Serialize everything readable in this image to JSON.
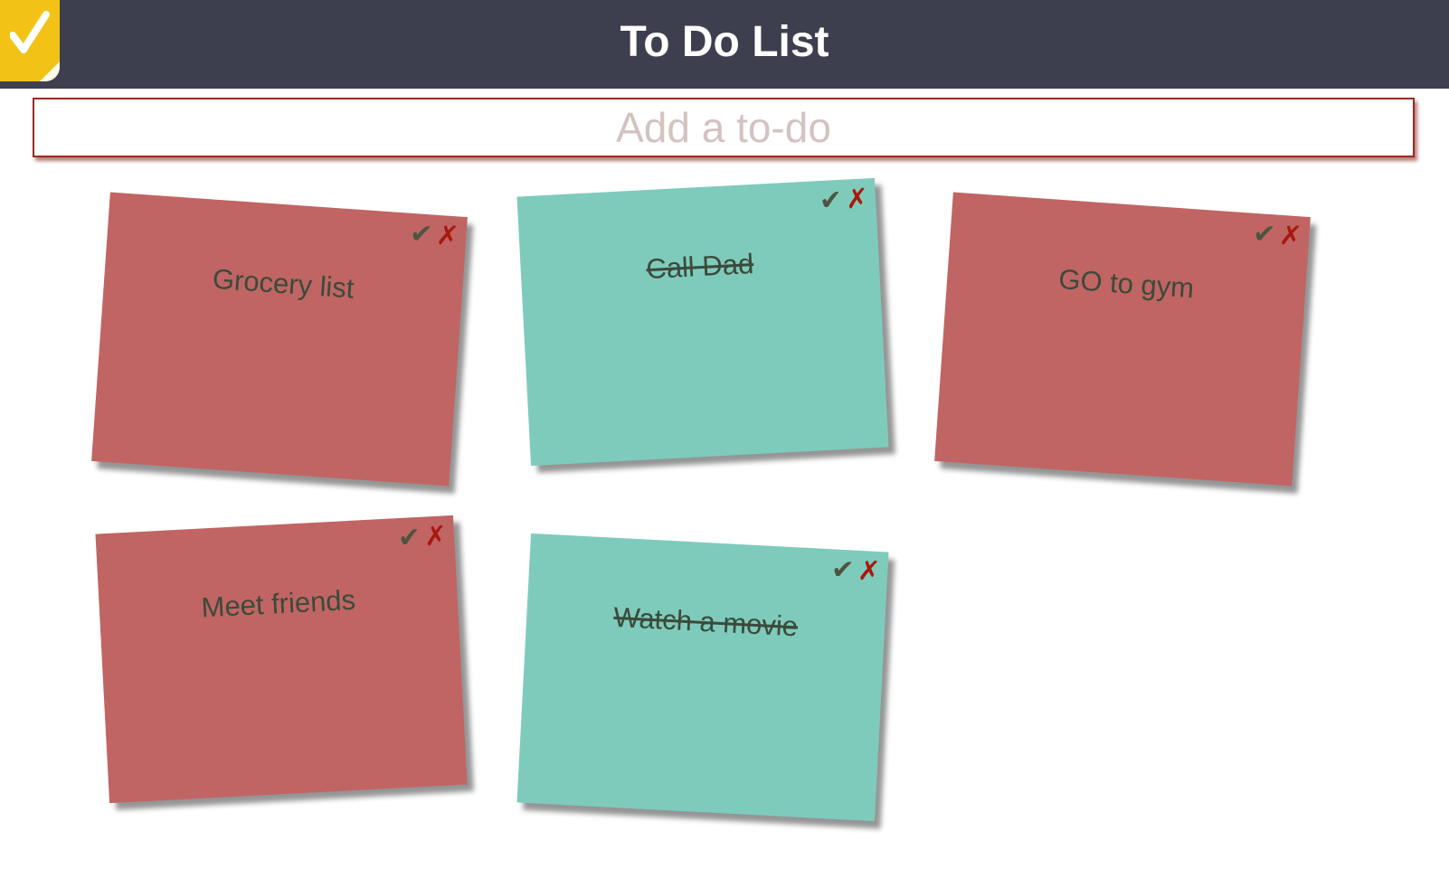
{
  "header": {
    "title": "To Do List",
    "logo_icon": "checkmark-logo-icon",
    "background_color": "#3d3f4f",
    "logo_color": "#f2c316"
  },
  "add_todo": {
    "placeholder": "Add a to-do",
    "value": ""
  },
  "notes": [
    {
      "title": "Grocery list",
      "completed": false,
      "color": "#c06564"
    },
    {
      "title": "Call Dad",
      "completed": true,
      "color": "#7ecbbc"
    },
    {
      "title": "GO to gym",
      "completed": false,
      "color": "#c06564"
    },
    {
      "title": "Meet friends",
      "completed": false,
      "color": "#c06564"
    },
    {
      "title": "Watch a movie",
      "completed": true,
      "color": "#7ecbbc"
    }
  ],
  "note_actions": {
    "complete_symbol": "✔",
    "delete_symbol": "✗",
    "complete_icon": "checkmark-icon",
    "delete_icon": "cross-icon"
  }
}
